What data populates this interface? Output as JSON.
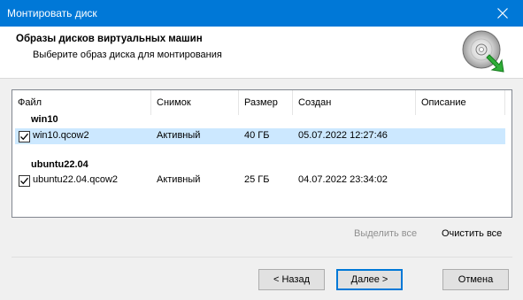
{
  "window": {
    "title": "Монтировать диск",
    "close_icon": "close-icon"
  },
  "header": {
    "title": "Образы дисков виртуальных машин",
    "subtitle": "Выберите образ диска для монтирования",
    "icon": "disc-mount-icon"
  },
  "list": {
    "columns": [
      "Файл",
      "Снимок",
      "Размер",
      "Создан",
      "Описание"
    ],
    "groups": [
      {
        "name": "win10",
        "rows": [
          {
            "checked": true,
            "file": "win10.qcow2",
            "snapshot": "Активный",
            "size": "40 ГБ",
            "created": "05.07.2022 12:27:46",
            "description": "",
            "selected": true
          }
        ]
      },
      {
        "name": "ubuntu22.04",
        "rows": [
          {
            "checked": true,
            "file": "ubuntu22.04.qcow2",
            "snapshot": "Активный",
            "size": "25 ГБ",
            "created": "04.07.2022 23:34:02",
            "description": "",
            "selected": false
          }
        ]
      }
    ]
  },
  "actions": {
    "select_all": "Выделить все",
    "clear_all": "Очистить все"
  },
  "buttons": {
    "back": "< Назад",
    "next": "Далее >",
    "cancel": "Отмена"
  },
  "colors": {
    "titlebar": "#0078d7",
    "selection": "#cce8ff"
  }
}
